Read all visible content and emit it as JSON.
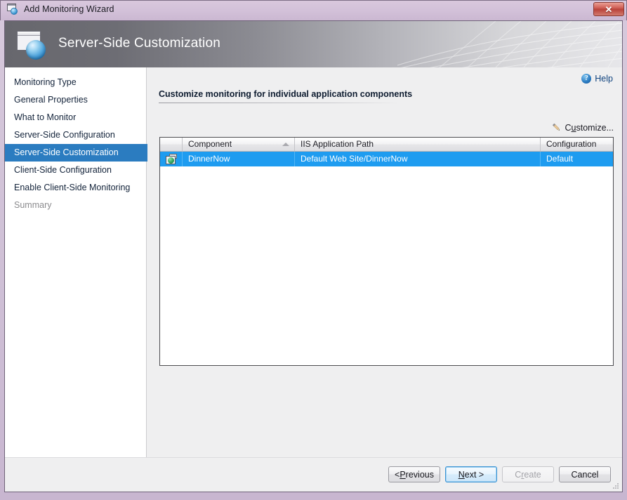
{
  "window": {
    "title": "Add Monitoring Wizard",
    "close_label": "✕",
    "icon": "window-sphere-icon"
  },
  "banner": {
    "title": "Server-Side Customization",
    "icon": "window-sphere-icon"
  },
  "sidebar": {
    "items": [
      {
        "label": "Monitoring Type",
        "state": "normal"
      },
      {
        "label": "General Properties",
        "state": "normal"
      },
      {
        "label": "What to Monitor",
        "state": "normal"
      },
      {
        "label": "Server-Side Configuration",
        "state": "normal"
      },
      {
        "label": "Server-Side Customization",
        "state": "selected"
      },
      {
        "label": "Client-Side Configuration",
        "state": "normal"
      },
      {
        "label": "Enable Client-Side Monitoring",
        "state": "normal"
      },
      {
        "label": "Summary",
        "state": "disabled"
      }
    ]
  },
  "main": {
    "help_label": "Help",
    "help_icon_glyph": "?",
    "section_title": "Customize monitoring for individual application components",
    "customize_label_pre": "C",
    "customize_label_accel": "u",
    "customize_label_post": "stomize...",
    "grid": {
      "columns": [
        {
          "key": "icon",
          "label": ""
        },
        {
          "key": "component",
          "label": "Component",
          "sorted": "ascending"
        },
        {
          "key": "path",
          "label": "IIS Application Path"
        },
        {
          "key": "config",
          "label": "Configuration"
        }
      ],
      "rows": [
        {
          "icon": "web-application-icon",
          "component": "DinnerNow",
          "path": "Default Web Site/DinnerNow",
          "config": "Default",
          "selected": true
        }
      ]
    }
  },
  "footer": {
    "buttons": [
      {
        "name": "previous",
        "pre": "< ",
        "accel": "P",
        "post": "revious",
        "state": "normal"
      },
      {
        "name": "next",
        "pre": "",
        "accel": "N",
        "post": "ext >",
        "state": "default"
      },
      {
        "name": "create",
        "pre": "C",
        "accel": "r",
        "post": "eate",
        "state": "disabled"
      },
      {
        "name": "cancel",
        "pre": "Cancel",
        "accel": "",
        "post": "",
        "state": "normal"
      }
    ]
  },
  "colors": {
    "accent_selected_nav": "#2b7cc0",
    "accent_selected_row": "#1e9cf0",
    "link": "#11447f",
    "title_bar": "#d3c1d9",
    "close_button": "#b9433a"
  }
}
